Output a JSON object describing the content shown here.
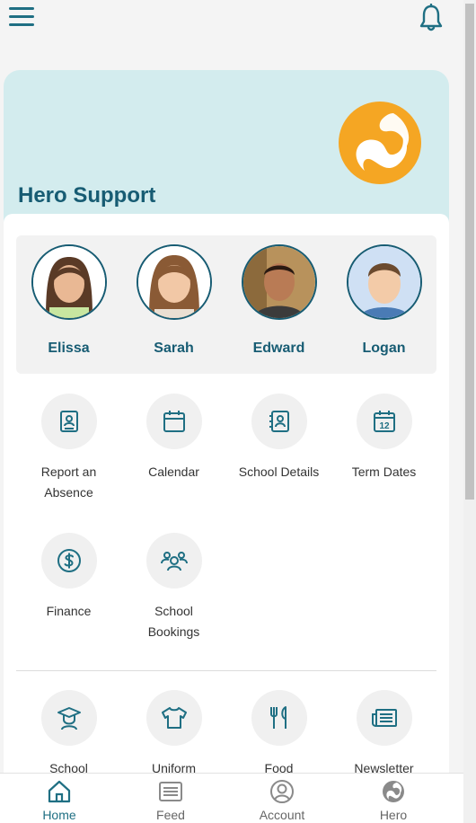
{
  "hero": {
    "title": "Hero Support"
  },
  "children": [
    {
      "name": "Elissa",
      "avatar": "girl-portrait"
    },
    {
      "name": "Sarah",
      "avatar": "girl-portrait"
    },
    {
      "name": "Edward",
      "avatar": "boy-portrait"
    },
    {
      "name": "Logan",
      "avatar": "boy-portrait"
    }
  ],
  "tiles": [
    {
      "label": "Report an Absence",
      "icon": "absence-report-icon"
    },
    {
      "label": "Calendar",
      "icon": "calendar-icon"
    },
    {
      "label": "School Details",
      "icon": "contact-book-icon"
    },
    {
      "label": "Term Dates",
      "icon": "dated-calendar-icon",
      "badge": "12"
    },
    {
      "label": "Finance",
      "icon": "dollar-icon"
    },
    {
      "label": "School Bookings",
      "icon": "group-icon"
    }
  ],
  "services": [
    {
      "label": "School",
      "icon": "graduate-icon"
    },
    {
      "label": "Uniform",
      "icon": "shirt-icon"
    },
    {
      "label": "Food",
      "icon": "cutlery-icon"
    },
    {
      "label": "Newsletter",
      "icon": "newspaper-icon"
    }
  ],
  "nav": {
    "items": [
      {
        "label": "Home",
        "icon": "home-icon",
        "active": true
      },
      {
        "label": "Feed",
        "icon": "feed-icon",
        "active": false
      },
      {
        "label": "Account",
        "icon": "account-icon",
        "active": false
      },
      {
        "label": "Hero",
        "icon": "hero-logo-icon",
        "active": false
      }
    ]
  },
  "colors": {
    "brand": "#175c73",
    "accent": "#f5a623",
    "hero_bg": "#d3ecee"
  }
}
